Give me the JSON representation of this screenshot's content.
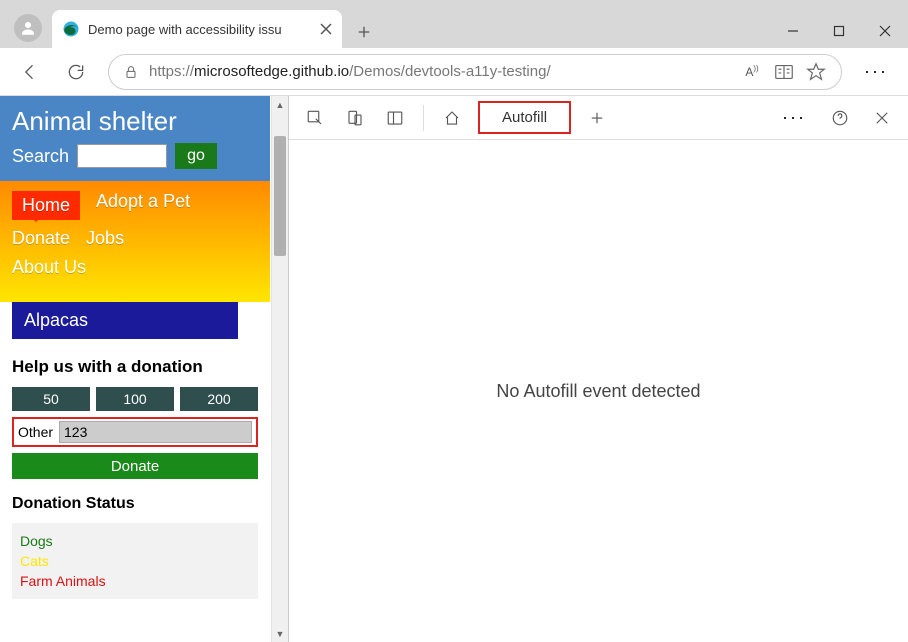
{
  "browser": {
    "tab_title": "Demo page with accessibility issu",
    "url_prefix": "https://",
    "url_host": "microsoftedge.github.io",
    "url_path": "/Demos/devtools-a11y-testing/"
  },
  "site": {
    "title": "Animal shelter",
    "search_label": "Search",
    "go_label": "go",
    "nav": {
      "home": "Home",
      "adopt": "Adopt a Pet",
      "donate": "Donate",
      "jobs": "Jobs",
      "about": "About Us"
    },
    "alpacas": "Alpacas",
    "donation": {
      "heading": "Help us with a donation",
      "amt50": "50",
      "amt100": "100",
      "amt200": "200",
      "other_label": "Other",
      "other_value": "123",
      "donate_label": "Donate"
    },
    "status": {
      "heading": "Donation Status",
      "dogs": "Dogs",
      "cats": "Cats",
      "farm": "Farm Animals"
    }
  },
  "devtools": {
    "tab_autofill": "Autofill",
    "body_text": "No Autofill event detected"
  }
}
